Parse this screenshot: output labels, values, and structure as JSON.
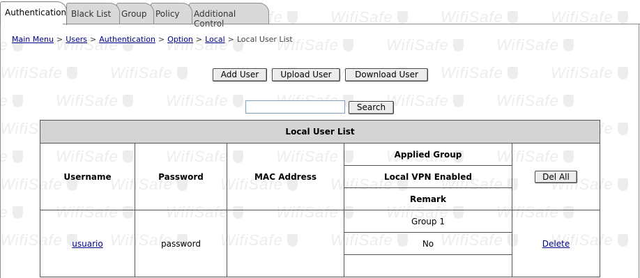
{
  "watermark": {
    "text": "WifiSafe"
  },
  "tabs": [
    {
      "label": "Authentication",
      "active": true
    },
    {
      "label": "Black List",
      "active": false
    },
    {
      "label": "Group",
      "active": false
    },
    {
      "label": "Policy",
      "active": false
    },
    {
      "label": "Additional Control",
      "active": false
    }
  ],
  "breadcrumb": {
    "links": [
      "Main Menu",
      "Users",
      "Authentication",
      "Option",
      "Local"
    ],
    "current": "Local User List",
    "separator": ">"
  },
  "actions": {
    "add_user": "Add User",
    "upload_user": "Upload User",
    "download_user": "Download User"
  },
  "search": {
    "value": "",
    "button_label": "Search"
  },
  "table": {
    "title": "Local User List",
    "headers": {
      "username": "Username",
      "password": "Password",
      "mac_address": "MAC Address",
      "applied_group": "Applied Group",
      "local_vpn_enabled": "Local VPN Enabled",
      "remark": "Remark",
      "del_all": "Del All"
    },
    "rows": [
      {
        "username": "usuario",
        "password": "password",
        "mac_address": "",
        "applied_group": "Group 1",
        "local_vpn_enabled": "No",
        "remark": "",
        "delete_label": "Delete"
      }
    ]
  }
}
